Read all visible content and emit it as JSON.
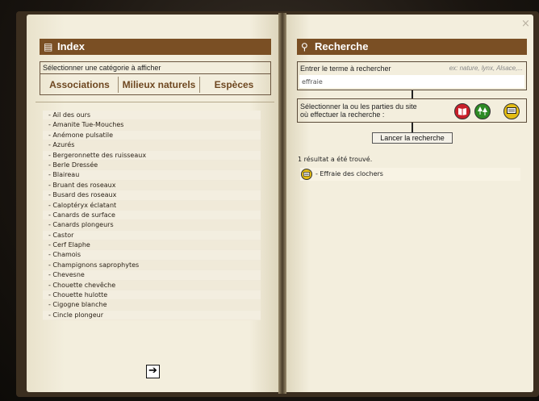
{
  "close_icon": "×",
  "index": {
    "title": "Index",
    "category_prompt": "Sélectionner une catégorie à afficher",
    "tabs": [
      "Associations",
      "Milieux naturels",
      "Espèces"
    ],
    "items": [
      "- Ail des ours",
      "- Amanite Tue-Mouches",
      "- Anémone pulsatile",
      "- Azurés",
      "- Bergeronnette des ruisseaux",
      "- Berle Dressée",
      "- Blaireau",
      "- Bruant des roseaux",
      "- Busard des roseaux",
      "- Caloptéryx éclatant",
      "- Canards de surface",
      "- Canards plongeurs",
      "- Castor",
      "- Cerf Elaphe",
      "- Chamois",
      "- Champignons saprophytes",
      "- Chevesne",
      "- Chouette chevêche",
      "- Chouette hulotte",
      "- Cigogne blanche",
      "- Cincle plongeur"
    ],
    "next_icon": "➔"
  },
  "search": {
    "title": "Recherche",
    "term_label": "Entrer le terme à rechercher",
    "term_hint": "ex: nature, lynx, Alsace,...",
    "term_value": "effraie",
    "parts_label": "Sélectionner la ou les parties du site où effectuer la recherche :",
    "launch_label": "Lancer la recherche",
    "result_count": "1 résultat a été trouvé.",
    "results": [
      "- Effraie des clochers"
    ],
    "icons": [
      "book-icon",
      "trees-icon",
      "speech-icon"
    ],
    "colors": {
      "red": "#c8202a",
      "green": "#2d8a24",
      "yellow": "#e3bc14",
      "header": "#7a4f24"
    }
  }
}
